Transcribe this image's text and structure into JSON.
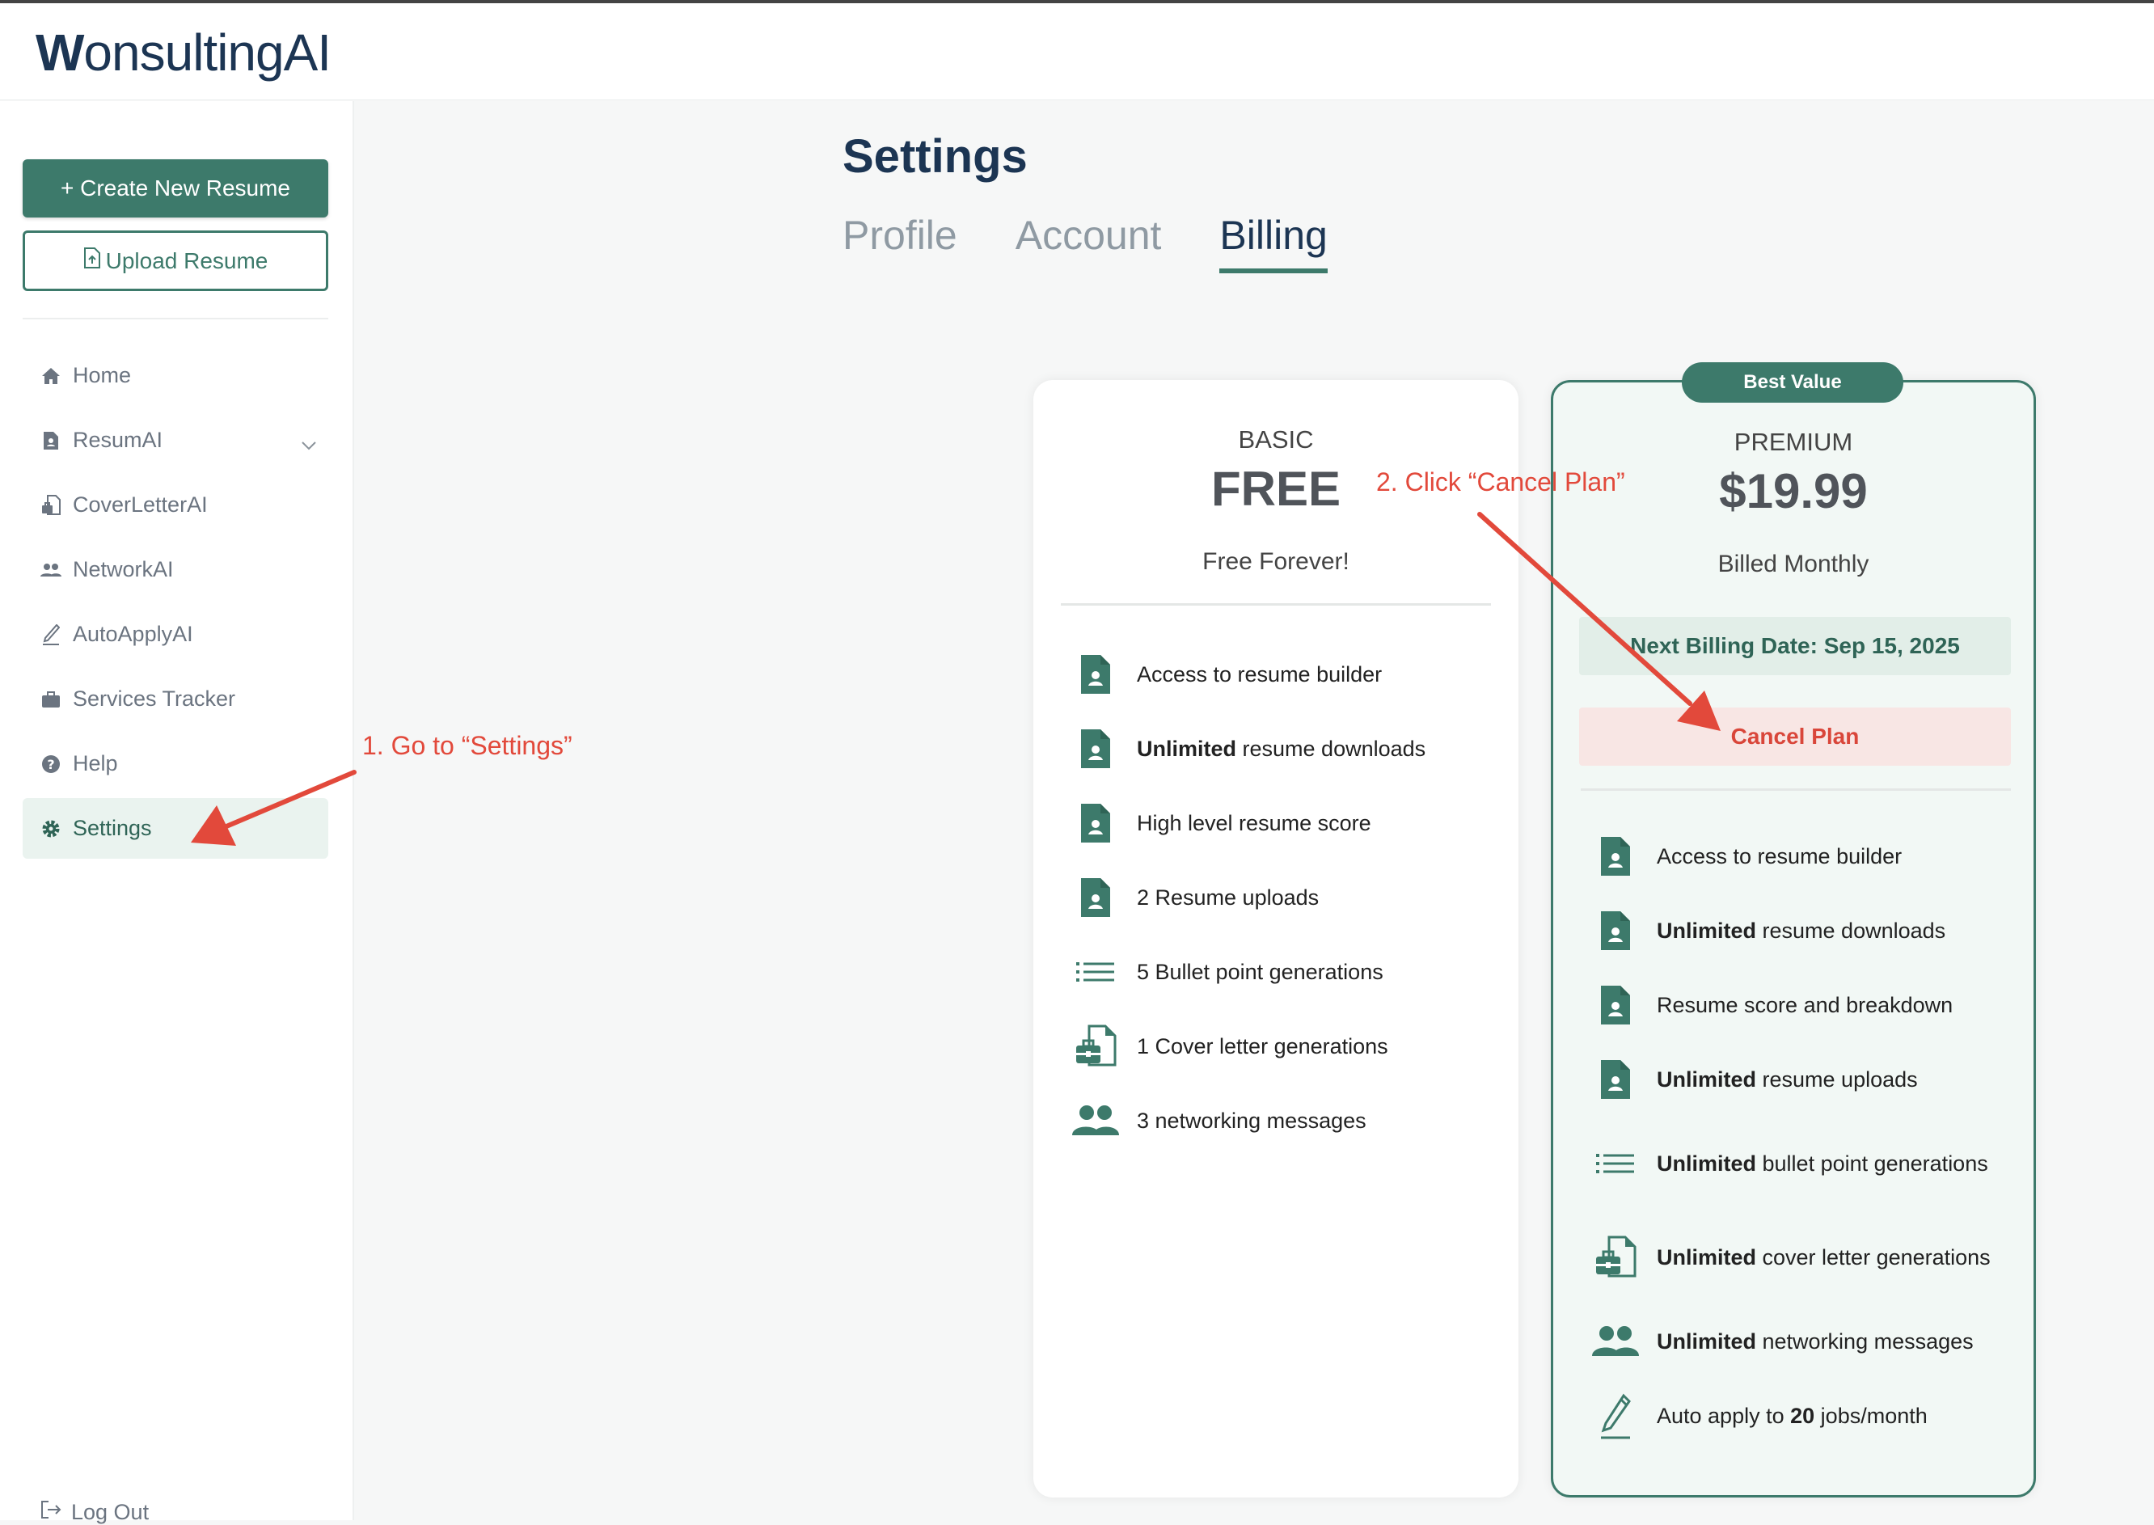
{
  "app": {
    "logo_bold": "W",
    "logo_rest": "onsultingAI"
  },
  "sidebar": {
    "create_label": "+ Create New Resume",
    "upload_label": "Upload Resume",
    "items": [
      {
        "label": "Home",
        "icon": "home-icon"
      },
      {
        "label": "ResumAI",
        "icon": "document-icon"
      },
      {
        "label": "CoverLetterAI",
        "icon": "cover-letter-icon"
      },
      {
        "label": "NetworkAI",
        "icon": "users-icon"
      },
      {
        "label": "AutoApplyAI",
        "icon": "pen-icon"
      },
      {
        "label": "Services Tracker",
        "icon": "briefcase-icon"
      },
      {
        "label": "Help",
        "icon": "help-icon"
      },
      {
        "label": "Settings",
        "icon": "gear-icon"
      }
    ],
    "logout_label": "Log Out"
  },
  "page": {
    "title": "Settings",
    "tabs": [
      "Profile",
      "Account",
      "Billing"
    ],
    "active_tab": "Billing"
  },
  "plans": {
    "basic": {
      "name": "BASIC",
      "price": "FREE",
      "subtitle": "Free Forever!",
      "features": [
        {
          "bold": "",
          "text": "Access to resume builder",
          "icon": "document-icon"
        },
        {
          "bold": "Unlimited",
          "text": " resume downloads",
          "icon": "document-icon"
        },
        {
          "bold": "",
          "text": "High level resume score",
          "icon": "document-icon"
        },
        {
          "bold": "",
          "text": "2 Resume uploads",
          "icon": "document-icon"
        },
        {
          "bold": "",
          "text": "5 Bullet point generations",
          "icon": "list-icon"
        },
        {
          "bold": "",
          "text": "1 Cover letter generations",
          "icon": "cover-letter-icon"
        },
        {
          "bold": "",
          "text": "3 networking messages",
          "icon": "users-icon"
        }
      ]
    },
    "premium": {
      "badge": "Best Value",
      "name": "PREMIUM",
      "price": "$19.99",
      "subtitle": "Billed Monthly",
      "next_billing": "Next Billing Date: Sep 15, 2025",
      "cancel_label": "Cancel Plan",
      "features": [
        {
          "pre": "",
          "bold": "",
          "text": "Access to resume builder",
          "icon": "document-icon"
        },
        {
          "pre": "",
          "bold": "Unlimited",
          "text": " resume downloads",
          "icon": "document-icon"
        },
        {
          "pre": "",
          "bold": "",
          "text": "Resume score and breakdown",
          "icon": "document-icon"
        },
        {
          "pre": "",
          "bold": "Unlimited",
          "text": " resume uploads",
          "icon": "document-icon"
        },
        {
          "pre": "",
          "bold": "Unlimited",
          "text": " bullet point generations",
          "icon": "list-icon"
        },
        {
          "pre": "",
          "bold": "Unlimited",
          "text": " cover letter generations",
          "icon": "cover-letter-icon"
        },
        {
          "pre": "",
          "bold": "Unlimited",
          "text": " networking messages",
          "icon": "users-icon"
        },
        {
          "pre": "Auto apply to ",
          "bold": "20",
          "text": " jobs/month",
          "icon": "pen-icon"
        }
      ]
    }
  },
  "annotations": {
    "step1": "1. Go to “Settings”",
    "step2": "2. Click “Cancel Plan”"
  },
  "colors": {
    "accent": "#3d7a6b",
    "annotation": "#e2493b",
    "title": "#1c3553"
  }
}
